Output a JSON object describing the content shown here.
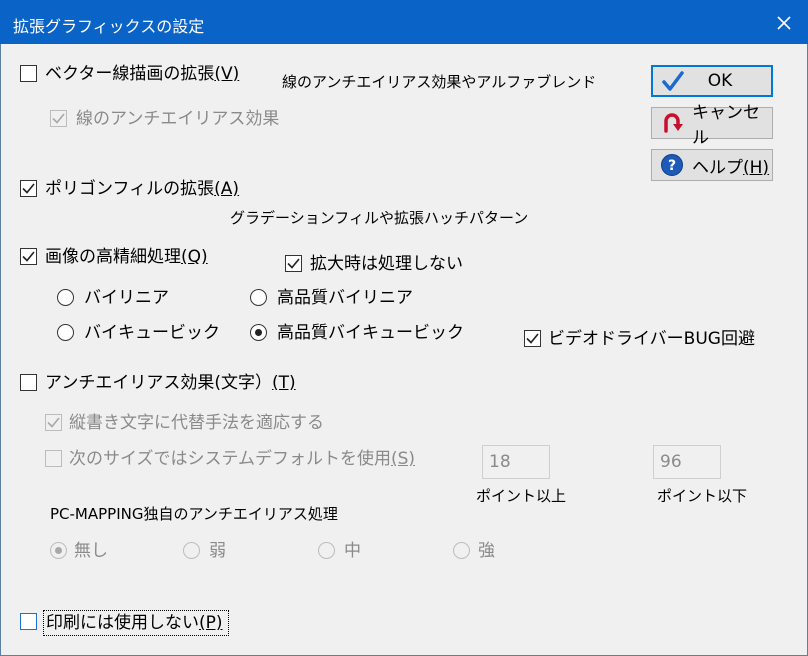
{
  "window": {
    "title": "拡張グラフィックスの設定"
  },
  "vector": {
    "label": "ベクター線描画の拡張",
    "key": "(V)",
    "desc": "線のアンチエイリアス効果やアルファブレンド",
    "antialias_label": "線のアンチエイリアス効果"
  },
  "polygon": {
    "label": "ポリゴンフィルの拡張",
    "key": "(A)",
    "desc": "グラデーションフィルや拡張ハッチパターン"
  },
  "image": {
    "label": "画像の高精細処理",
    "key": "(Q)",
    "no_enlarge_label": "拡大時は処理しない",
    "radio": {
      "bilinear": "バイリニア",
      "hq_bilinear": "高品質バイリニア",
      "bicubic": "バイキュービック",
      "hq_bicubic": "高品質バイキュービック"
    },
    "video_bug_label": "ビデオドライバーBUG回避"
  },
  "text_aa": {
    "label": "アンチエイリアス効果(文字）",
    "key": "(T)",
    "vertical_label": "縦書き文字に代替手法を適応する",
    "default_size_label": "次のサイズではシステムデフォルトを使用",
    "default_size_key": "(S)",
    "min_value": "18",
    "min_unit": "ポイント以上",
    "max_value": "96",
    "max_unit": "ポイント以下",
    "own_label": "PC-MAPPING独自のアンチエイリアス処理",
    "levels": {
      "none": "無し",
      "weak": "弱",
      "mid": "中",
      "strong": "強"
    }
  },
  "print": {
    "label": "印刷には使用しない",
    "key": "(P)"
  },
  "buttons": {
    "ok": "OK",
    "cancel": "キャンセル",
    "help": "ヘルプ",
    "help_key": "(H)"
  },
  "colors": {
    "titlebar": "#0a64c8",
    "accent": "#0078d7",
    "cancel_icon": "#c8102e"
  }
}
